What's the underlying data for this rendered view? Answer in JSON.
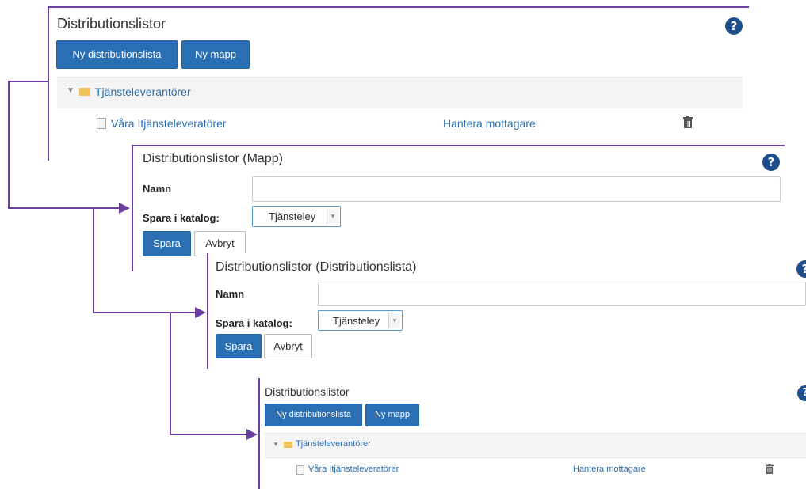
{
  "colors": {
    "accent": "#2a6fb3",
    "connector": "#6b3fa0",
    "help": "#1f4e8c",
    "folder": "#f0c15a"
  },
  "panel1": {
    "title": "Distributionslistor",
    "help": "?",
    "new_list_button": "Ny distributionslista",
    "new_folder_button": "Ny mapp",
    "folder_name": "Tjänsteleverantörer",
    "item_name": "Våra Itjänsteleveratörer",
    "manage_link": "Hantera mottagare",
    "icons": {
      "expand": "triangle-down-icon",
      "folder": "folder-icon",
      "document": "document-icon",
      "delete": "trash-icon",
      "help": "question-circle-icon"
    }
  },
  "panel2": {
    "title": "Distributionslistor (Mapp)",
    "help": "?",
    "name_label": "Namn",
    "name_value": "",
    "catalog_label": "Spara i katalog:",
    "catalog_value": "Tjänsteley",
    "save_button": "Spara",
    "cancel_button": "Avbryt"
  },
  "panel3": {
    "title": "Distributionslistor (Distributionslista)",
    "help": "?",
    "name_label": "Namn",
    "name_value": "",
    "catalog_label": "Spara i katalog:",
    "catalog_value": "Tjänsteley",
    "save_button": "Spara",
    "cancel_button": "Avbryt"
  },
  "panel4": {
    "title": "Distributionslistor",
    "help": "?",
    "new_list_button": "Ny distributionslista",
    "new_folder_button": "Ny mapp",
    "folder_name": "Tjänsteleverantörer",
    "item_name": "Våra Itjänsteleveratörer",
    "manage_link": "Hantera mottagare"
  }
}
